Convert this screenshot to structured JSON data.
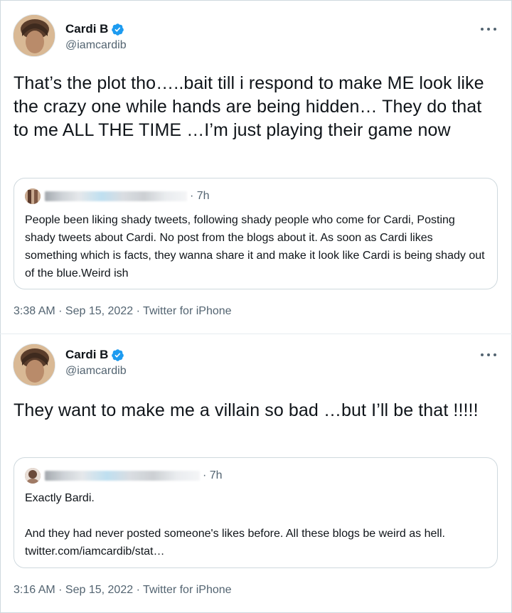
{
  "tweets": [
    {
      "author": {
        "name": "Cardi B",
        "handle": "@iamcardib"
      },
      "text": "That’s the plot tho…..bait till i respond to make ME look like the crazy one while hands are being hidden… They do that to me ALL THE TIME …I’m just playing their game now",
      "quote": {
        "time": "· 7h",
        "text": "People been liking shady tweets, following shady people who come for Cardi, Posting shady tweets about Cardi. No post from the blogs about it. As soon as Cardi likes something which is facts, they wanna share it and make it look like Cardi is being shady out of the blue.Weird ish"
      },
      "meta": "3:38 AM · Sep 15, 2022 · Twitter for iPhone"
    },
    {
      "author": {
        "name": "Cardi B",
        "handle": "@iamcardib"
      },
      "text": "They want to make me a villain so bad …but I’ll be that !!!!!",
      "quote": {
        "time": "· 7h",
        "text": "Exactly Bardi.\n\nAnd they had never posted someone's likes before. All these blogs be weird as hell. twitter.com/iamcardib/stat…"
      },
      "meta": "3:16 AM · Sep 15, 2022 · Twitter for iPhone"
    }
  ],
  "icons": {
    "verified": "verified-badge-icon",
    "more": "more-options-icon"
  },
  "colors": {
    "verified": "#1d9bf0",
    "secondary_text": "#536471",
    "primary_text": "#0f1419",
    "border": "#cfd9de"
  }
}
